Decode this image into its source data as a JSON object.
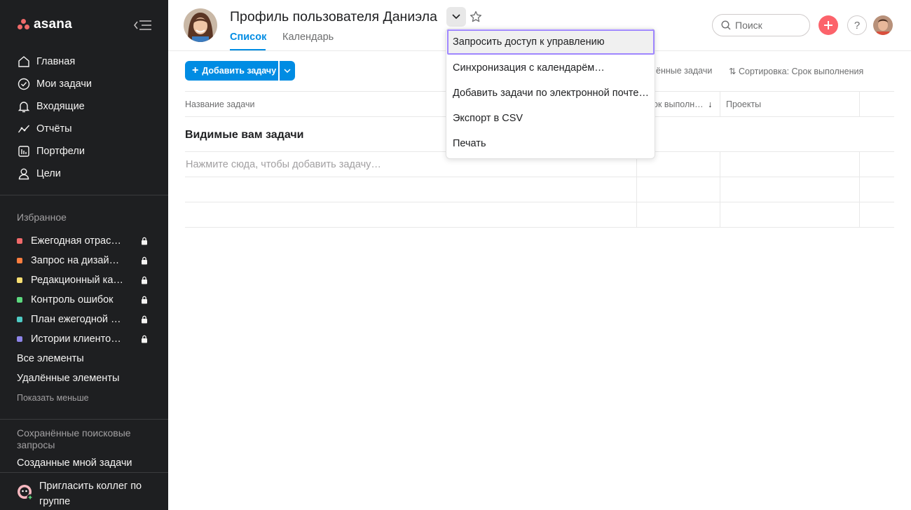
{
  "brand": {
    "name": "asana",
    "accent": "#f06a6a"
  },
  "sidebar": {
    "nav": [
      {
        "label": "Главная",
        "icon": "home-icon"
      },
      {
        "label": "Мои задачи",
        "icon": "check-circle-icon"
      },
      {
        "label": "Входящие",
        "icon": "bell-icon"
      },
      {
        "label": "Отчёты",
        "icon": "trend-line-icon"
      },
      {
        "label": "Портфели",
        "icon": "portfolio-icon"
      },
      {
        "label": "Цели",
        "icon": "person-icon"
      }
    ],
    "favorites_label": "Избранное",
    "favorites": [
      {
        "label": "Ежегодная отрас…",
        "color": "#f06a6a"
      },
      {
        "label": "Запрос на дизайн…",
        "color": "#fd7e3f"
      },
      {
        "label": "Редакционный ка…",
        "color": "#f8df72"
      },
      {
        "label": "Контроль ошибок",
        "color": "#5cd97f"
      },
      {
        "label": "План ежегодной …",
        "color": "#4ecbc4"
      },
      {
        "label": "Истории клиенто…",
        "color": "#8d84e8"
      }
    ],
    "all_items": "Все элементы",
    "deleted_items": "Удалённые элементы",
    "show_less": "Показать меньше",
    "saved_searches_label": "Сохранённые поисковые запросы",
    "created_by_me": "Созданные мной задачи",
    "invite_label": "Пригласить коллег по группе"
  },
  "header": {
    "title": "Профиль пользователя Даниэла",
    "tabs": [
      "Список",
      "Календарь"
    ],
    "search_placeholder": "Поиск",
    "help": "?"
  },
  "toolbar": {
    "add_task": "Добавить задачу",
    "completed_filter": "ённые задачи",
    "sort": "Сортировка: Срок выполнения"
  },
  "table": {
    "columns": [
      "Название задачи",
      "ок выполн…",
      "Проекты"
    ],
    "section_title": "Видимые вам задачи",
    "add_hint": "Нажмите сюда, чтобы добавить задачу…"
  },
  "menu": {
    "items": [
      "Запросить доступ к управлению",
      "Синхронизация с календарём…",
      "Добавить задачи по электронной почте…",
      "Экспорт в CSV",
      "Печать"
    ]
  }
}
